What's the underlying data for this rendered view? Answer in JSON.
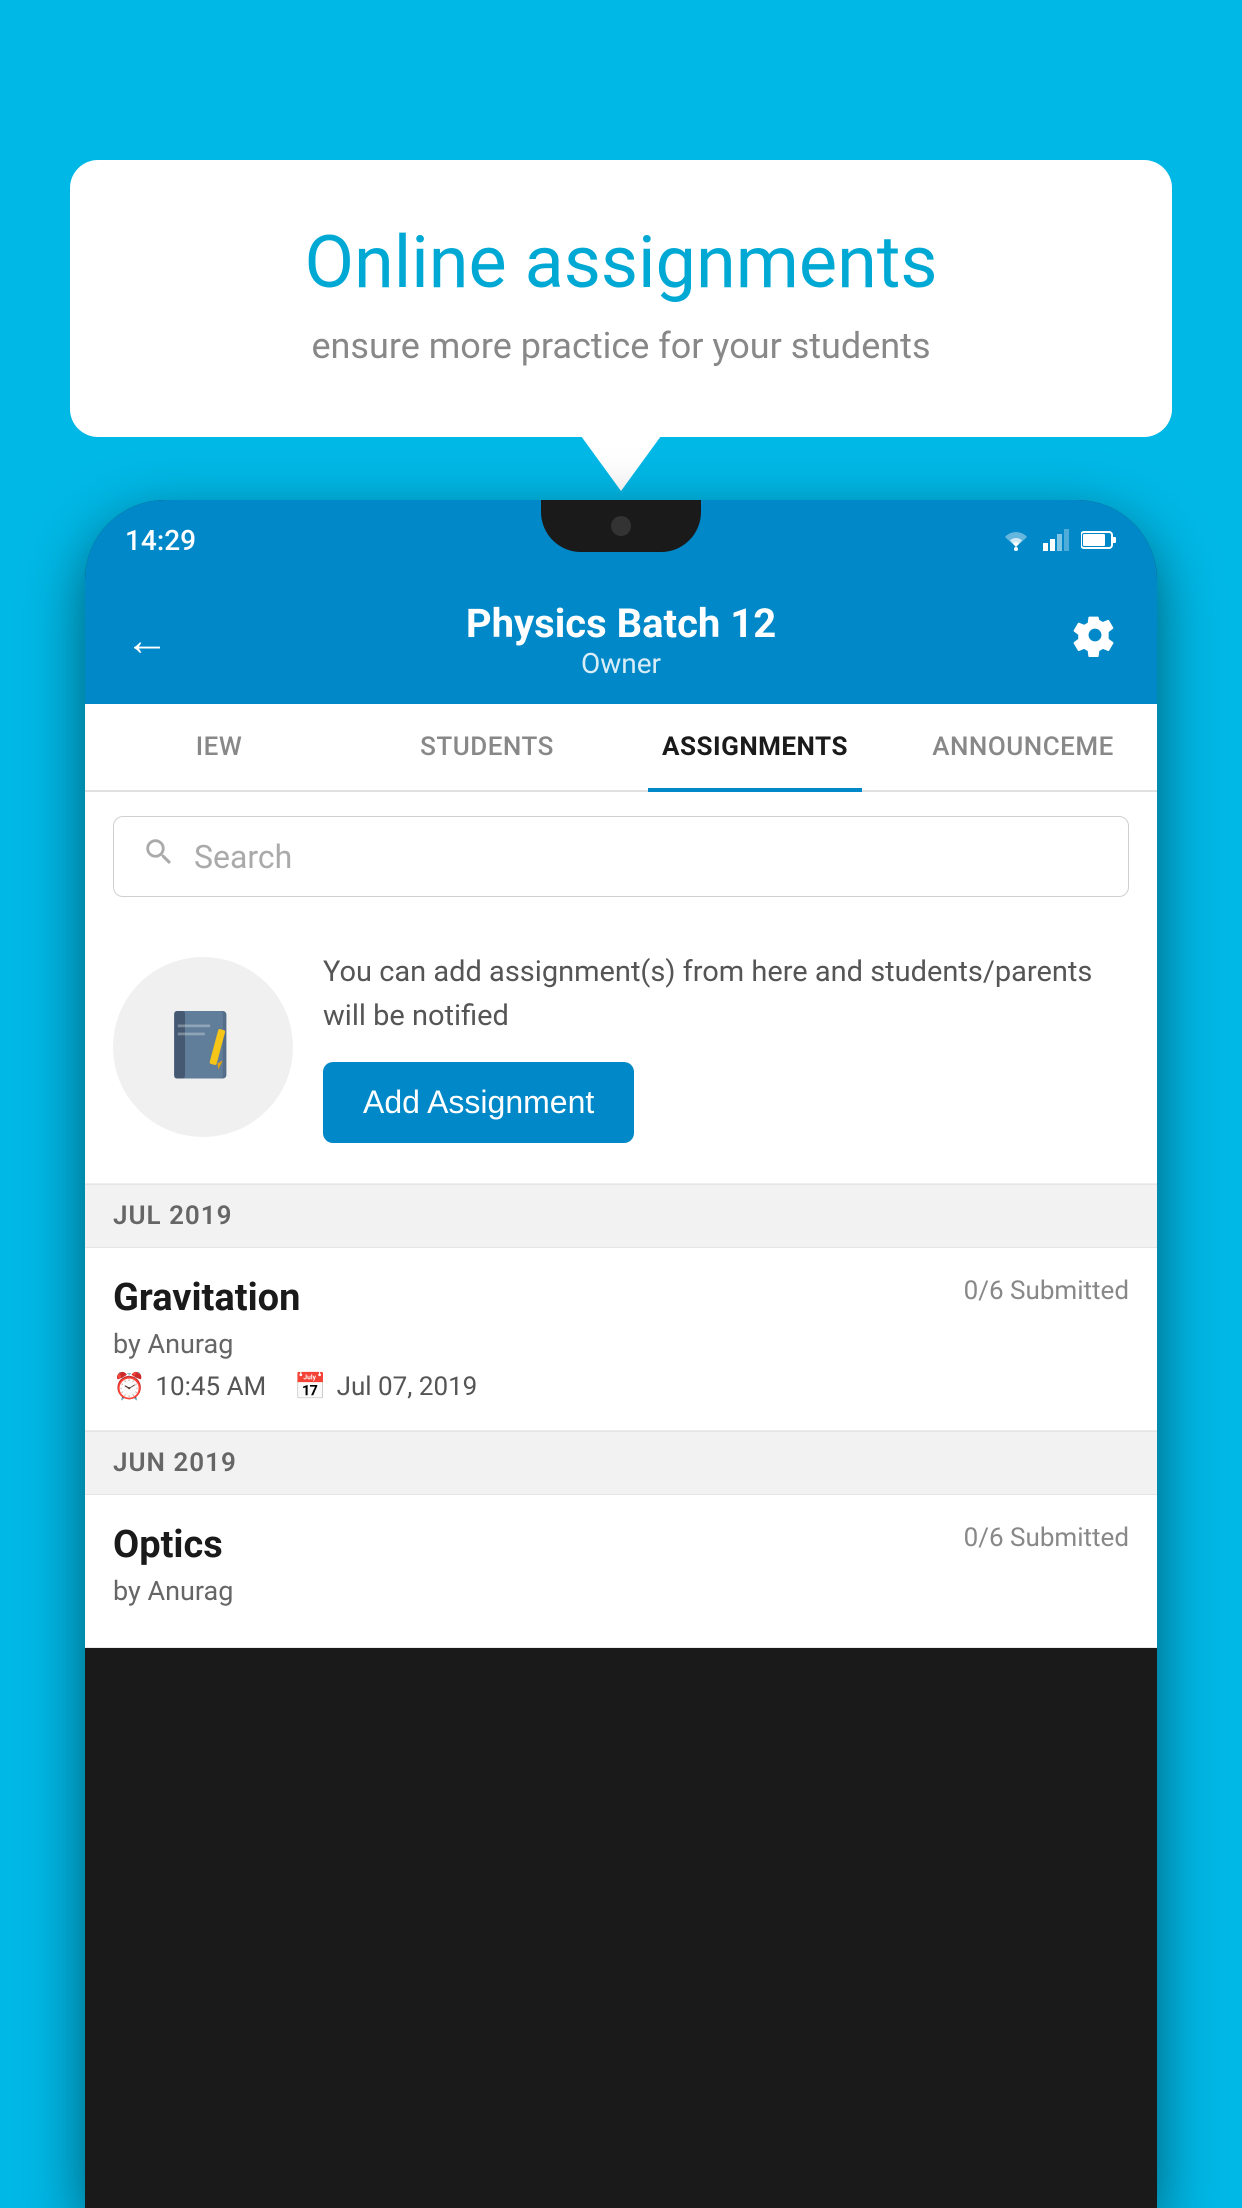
{
  "promo": {
    "title": "Online assignments",
    "subtitle": "ensure more practice for your students"
  },
  "status_bar": {
    "time": "14:29"
  },
  "app_bar": {
    "title": "Physics Batch 12",
    "subtitle": "Owner",
    "back_label": "←",
    "settings_label": "⚙"
  },
  "tabs": [
    {
      "label": "IEW",
      "active": false
    },
    {
      "label": "STUDENTS",
      "active": false
    },
    {
      "label": "ASSIGNMENTS",
      "active": true
    },
    {
      "label": "ANNOUNCEME",
      "active": false
    }
  ],
  "search": {
    "placeholder": "Search"
  },
  "empty_state": {
    "description": "You can add assignment(s) from here and students/parents will be notified",
    "button_label": "Add Assignment"
  },
  "sections": [
    {
      "header": "JUL 2019",
      "assignments": [
        {
          "name": "Gravitation",
          "submitted": "0/6 Submitted",
          "by": "by Anurag",
          "time": "10:45 AM",
          "date": "Jul 07, 2019"
        }
      ]
    },
    {
      "header": "JUN 2019",
      "assignments": [
        {
          "name": "Optics",
          "submitted": "0/6 Submitted",
          "by": "by Anurag",
          "time": "",
          "date": ""
        }
      ]
    }
  ]
}
